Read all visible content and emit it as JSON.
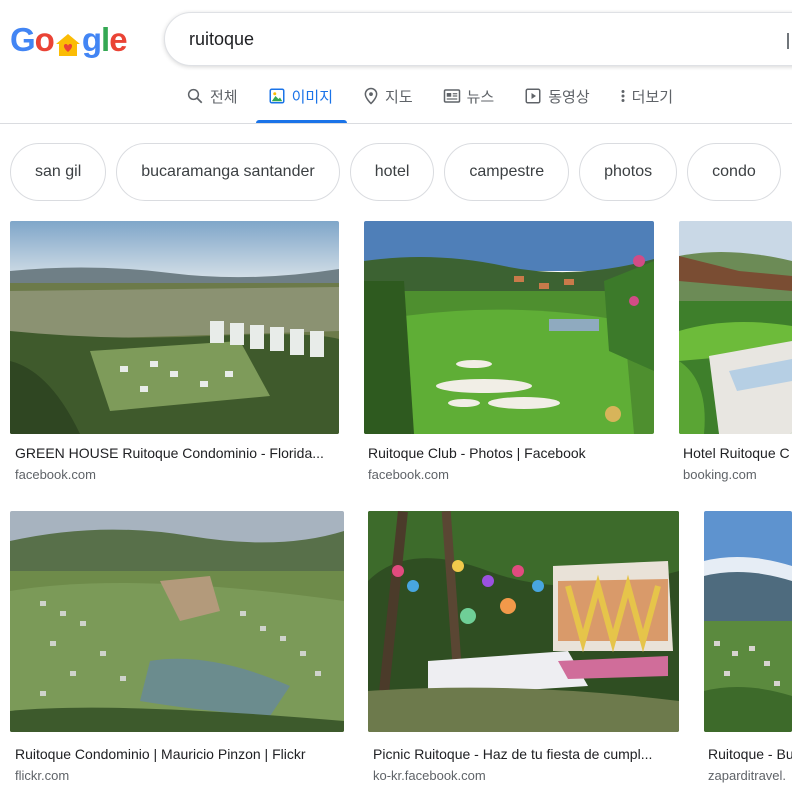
{
  "logo": {
    "letters": [
      "G",
      "o",
      "g",
      "l",
      "e"
    ],
    "colors": [
      "#4285f4",
      "#ea4335",
      "#4285f4",
      "#34a853",
      "#ea4335"
    ]
  },
  "search": {
    "query": "ruitoque"
  },
  "tabs": [
    {
      "label": "전체",
      "icon": "search-icon"
    },
    {
      "label": "이미지",
      "icon": "image-icon",
      "active": true
    },
    {
      "label": "지도",
      "icon": "map-pin-icon"
    },
    {
      "label": "뉴스",
      "icon": "news-icon"
    },
    {
      "label": "동영상",
      "icon": "video-icon"
    },
    {
      "label": "더보기",
      "icon": "more-vertical-icon"
    }
  ],
  "chips": [
    "san gil",
    "bucaramanga santander",
    "hotel",
    "campestre",
    "photos",
    "condo"
  ],
  "results": [
    {
      "title": "GREEN HOUSE Ruitoque Condominio - Florida...",
      "source": "facebook.com"
    },
    {
      "title": "Ruitoque Club - Photos | Facebook",
      "source": "facebook.com"
    },
    {
      "title": "Hotel Ruitoque C",
      "source": "booking.com"
    },
    {
      "title": "Ruitoque Condominio | Mauricio Pinzon | Flickr",
      "source": "flickr.com"
    },
    {
      "title": "Picnic Ruitoque - Haz de tu fiesta de cumpl...",
      "source": "ko-kr.facebook.com"
    },
    {
      "title": "Ruitoque - Bu",
      "source": "zaparditravel."
    }
  ],
  "colors": {
    "accent": "#1a73e8",
    "text": "#202124",
    "muted": "#5f6368",
    "border": "#dadce0"
  }
}
